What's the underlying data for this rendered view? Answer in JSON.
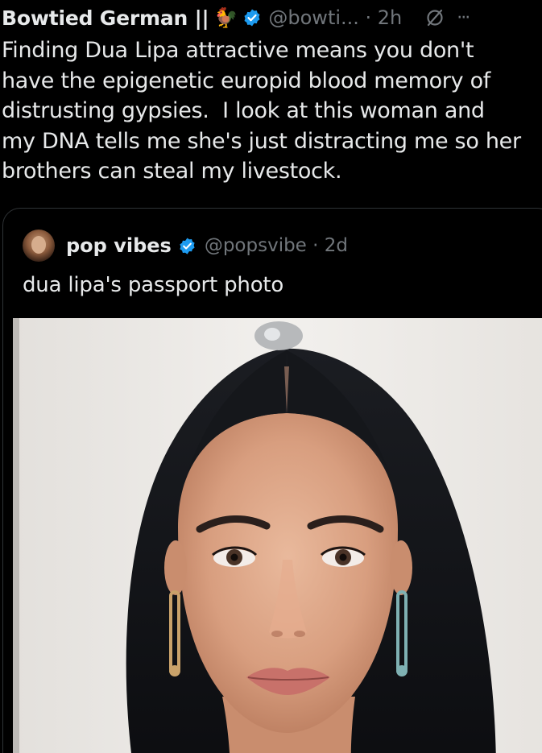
{
  "tweet": {
    "display_name": "Bowtied German ||",
    "emoji": "🐓",
    "handle_time": "@bowti... · 2h",
    "more": "···",
    "text": "Finding Dua Lipa attractive means you don't\nhave the epigenetic europid blood memory of\ndistrusting gypsies.  I look at this woman and\nmy DNA tells me she's just distracting me so her\nbrothers can steal my livestock."
  },
  "quote": {
    "display_name": "pop vibes",
    "handle_time": "@popsvibe · 2d",
    "text": "dua lipa's passport photo"
  },
  "icons": {
    "verified": "verified-badge-icon",
    "grok": "grok-slash-icon",
    "more": "more-dots-icon"
  },
  "colors": {
    "background": "#000000",
    "primary_text": "#e7e9ea",
    "secondary_text": "#71767b",
    "verified_blue": "#1d9bf0",
    "border": "#2f3336"
  }
}
